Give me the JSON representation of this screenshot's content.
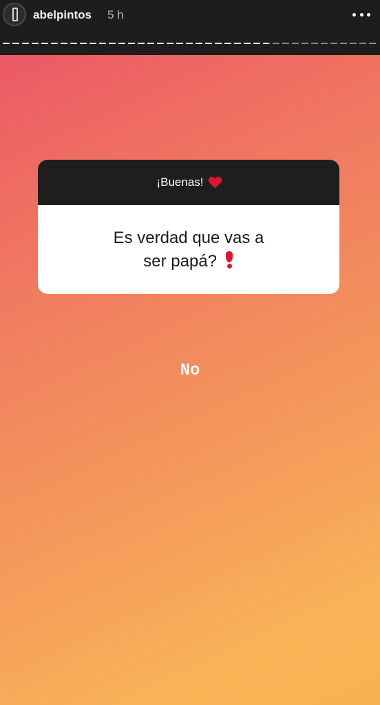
{
  "header": {
    "username": "abelpintos",
    "time": "5 h",
    "avatar_icon": "profile-avatar",
    "more_icon": "more-horizontal-icon"
  },
  "story_progress": {
    "fraction": 0.71
  },
  "question_sticker": {
    "title": "¡Buenas!",
    "title_emoji": "heart-icon",
    "question_line1": "Es verdad que vas a",
    "question_line2": "ser papá?",
    "question_emoji": "exclamation-icon"
  },
  "answer": {
    "text": "No"
  },
  "colors": {
    "background_top": "#ea5068",
    "background_bottom": "#f9b457",
    "header_bg": "#1d1d1d",
    "emoji_red": "#e0142f"
  }
}
